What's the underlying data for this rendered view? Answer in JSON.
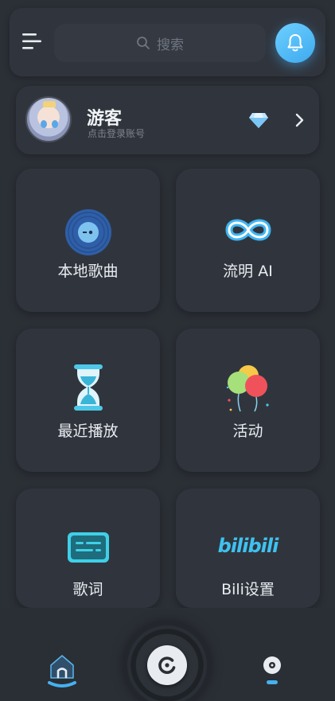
{
  "search": {
    "placeholder": "搜索"
  },
  "profile": {
    "name": "游客",
    "subtitle": "点击登录账号"
  },
  "tiles": [
    {
      "label": "本地歌曲",
      "icon": "vinyl-disc-icon"
    },
    {
      "label": "流明 AI",
      "icon": "infinity-icon"
    },
    {
      "label": "最近播放",
      "icon": "hourglass-icon"
    },
    {
      "label": "活动",
      "icon": "balloons-icon"
    },
    {
      "label": "歌词",
      "icon": "lyrics-icon"
    },
    {
      "label": "Bili设置",
      "icon": "bilibili-icon",
      "logo_text": "bilibili"
    }
  ],
  "colors": {
    "background": "#2b2f36",
    "card": "#30353d",
    "accent": "#4fb8f5",
    "teal": "#3fd0e8"
  },
  "bottom_nav": [
    "home-icon",
    "player-icon",
    "disc-icon"
  ]
}
